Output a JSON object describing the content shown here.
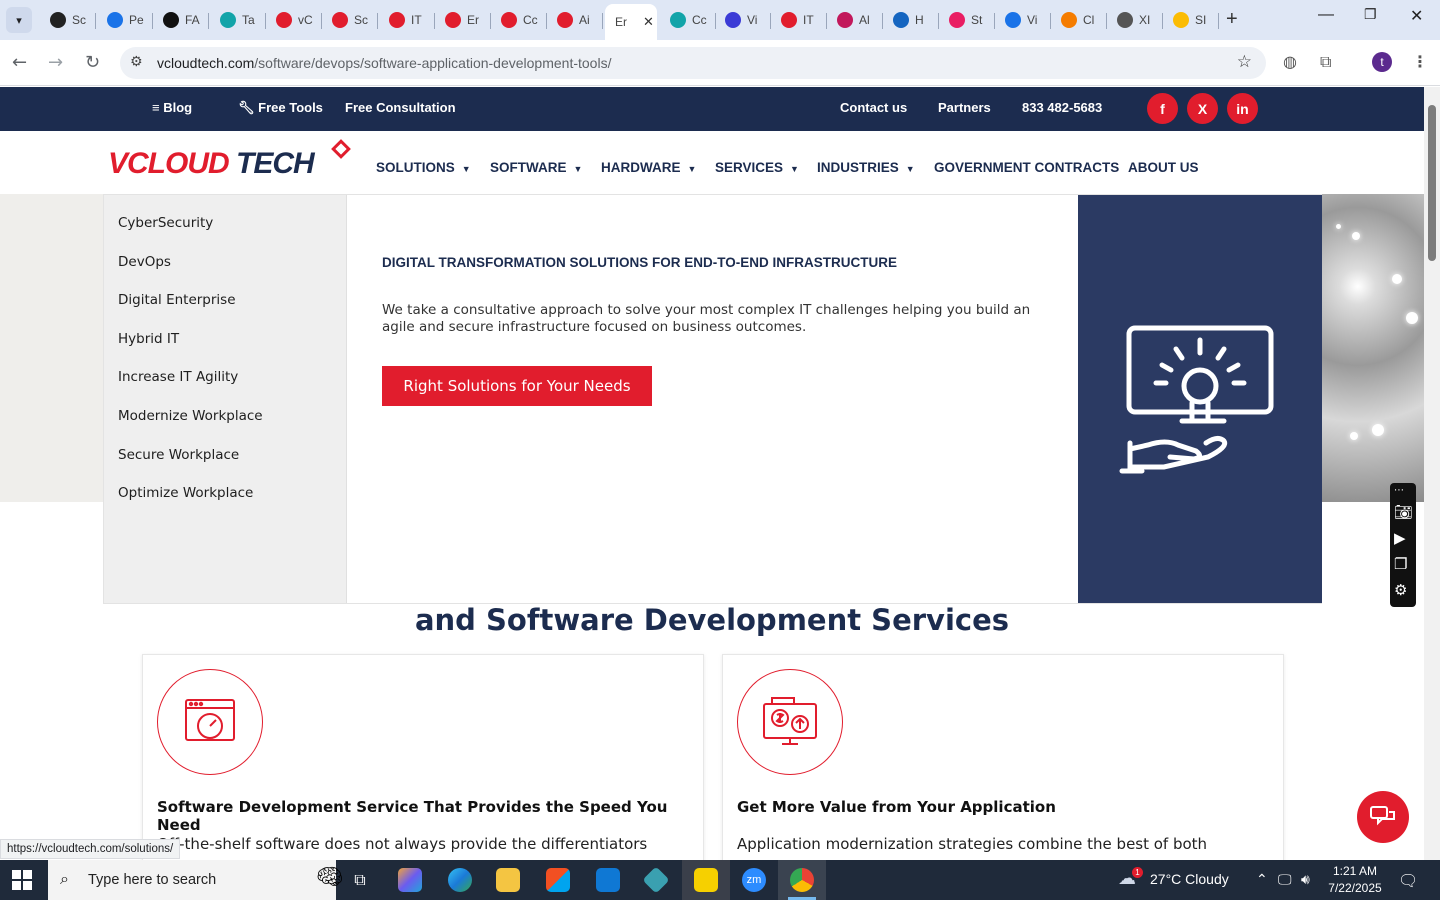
{
  "browser": {
    "tabs": [
      {
        "label": "Sc",
        "color": "#222222"
      },
      {
        "label": "Pe",
        "color": "#1a73e8"
      },
      {
        "label": "FA",
        "color": "#111111"
      },
      {
        "label": "Ta",
        "color": "#12a4a9"
      },
      {
        "label": "vC",
        "color": "#e11d2d"
      },
      {
        "label": "Sc",
        "color": "#e11d2d"
      },
      {
        "label": "IT",
        "color": "#e11d2d"
      },
      {
        "label": "Er",
        "color": "#e11d2d"
      },
      {
        "label": "Cc",
        "color": "#e11d2d"
      },
      {
        "label": "Ai",
        "color": "#e11d2d"
      },
      {
        "label": "Er",
        "color": "#ffffff"
      },
      {
        "label": "Cc",
        "color": "#12a4a9"
      },
      {
        "label": "Vi",
        "color": "#3b3bd6"
      },
      {
        "label": "IT",
        "color": "#e11d2d"
      },
      {
        "label": "Al",
        "color": "#c2185b"
      },
      {
        "label": "H",
        "color": "#1565c0"
      },
      {
        "label": "St",
        "color": "#e91e63"
      },
      {
        "label": "Vi",
        "color": "#1a73e8"
      },
      {
        "label": "Cl",
        "color": "#f57c00"
      },
      {
        "label": "XI",
        "color": "#555555"
      },
      {
        "label": "SI",
        "color": "#fbbc04"
      }
    ],
    "url_host": "vcloudtech.com",
    "url_path": "/software/devops/software-application-development-tools/",
    "profile_initial": "t"
  },
  "topbar": {
    "blog": "Blog",
    "free_tools": "Free Tools",
    "free_consultation": "Free Consultation",
    "contact": "Contact us",
    "partners": "Partners",
    "phone": "833 482-5683",
    "social_facebook": "f",
    "social_x": "X",
    "social_linkedin": "in"
  },
  "logo": {
    "part1": "VCLOUD",
    "part2": "TECH"
  },
  "nav": [
    {
      "label": "SOLUTIONS",
      "dropdown": true
    },
    {
      "label": "SOFTWARE",
      "dropdown": true
    },
    {
      "label": "HARDWARE",
      "dropdown": true
    },
    {
      "label": "SERVICES",
      "dropdown": true
    },
    {
      "label": "INDUSTRIES",
      "dropdown": true
    },
    {
      "label": "GOVERNMENT CONTRACTS",
      "dropdown": false
    },
    {
      "label": "ABOUT US",
      "dropdown": false
    }
  ],
  "mega_menu": {
    "items": [
      "CyberSecurity",
      "DevOps",
      "Digital Enterprise",
      "Hybrid IT",
      "Increase IT Agility",
      "Modernize Workplace",
      "Secure Workplace",
      "Optimize Workplace"
    ],
    "title": "DIGITAL TRANSFORMATION SOLUTIONS FOR END-TO-END INFRASTRUCTURE",
    "desc_line1": "We take a consultative approach to solve your most complex IT challenges helping you build an",
    "desc_line2": "agile and secure infrastructure focused on business outcomes.",
    "button": "Right Solutions for Your Needs"
  },
  "section": {
    "title": "and Software Development Services"
  },
  "cards": [
    {
      "title": "Software Development Service That Provides the Speed You Need",
      "text": "Off-the-shelf software does not always provide the differentiators"
    },
    {
      "title": "Get More Value from Your Application",
      "text": "Application modernization strategies combine the best of both"
    }
  ],
  "status_url": "https://vcloudtech.com/solutions/",
  "taskbar": {
    "search_placeholder": "Type here to search",
    "weather": "27°C  Cloudy",
    "weather_badge": "1",
    "time": "1:21 AM",
    "date": "7/22/2025"
  }
}
